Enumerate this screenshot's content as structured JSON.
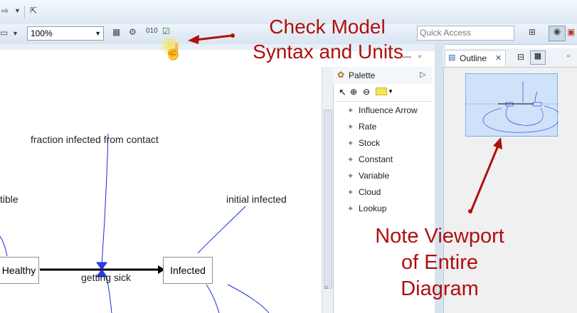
{
  "toolbar": {
    "zoom_value": "100%",
    "quick_access_placeholder": "Quick Access"
  },
  "editor": {
    "nodes": {
      "healthy": "Healthy",
      "infected": "Infected"
    },
    "labels": {
      "fraction_infected": "fraction infected from contact",
      "initial_infected": "initial infected",
      "susceptible_partial": "tible",
      "getting_sick": "getting sick"
    }
  },
  "palette": {
    "title": "Palette",
    "items": [
      "Influence Arrow",
      "Rate",
      "Stock",
      "Constant",
      "Variable",
      "Cloud",
      "Lookup"
    ]
  },
  "outline": {
    "tab_label": "Outline"
  },
  "annotations": {
    "check_model_line1": "Check Model",
    "check_model_line2": "Syntax and Units",
    "note_line1": "Note Viewport",
    "note_line2": "of Entire",
    "note_line3": "Diagram"
  },
  "colors": {
    "annotation_red": "#b00f0f",
    "link_blue": "#1a2bd6",
    "flow_black": "#000000"
  }
}
